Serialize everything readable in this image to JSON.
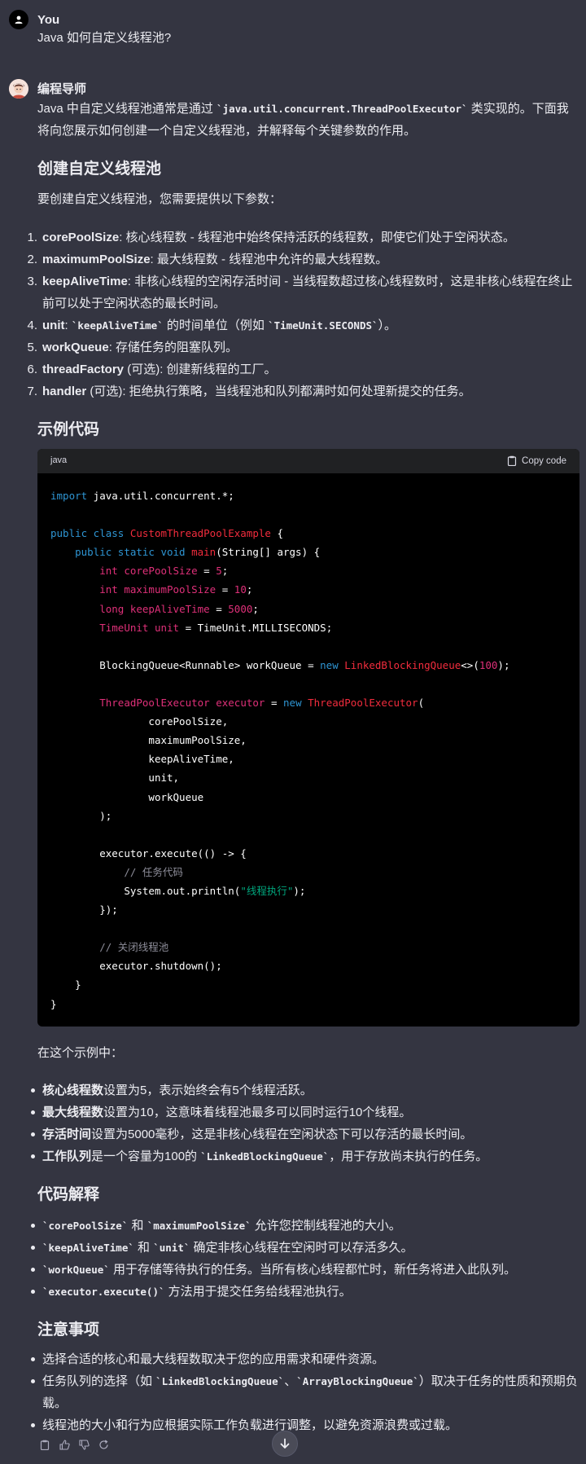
{
  "user": {
    "author": "You",
    "question": "Java 如何自定义线程池?"
  },
  "assistant": {
    "author": "编程导师",
    "intro_pre": "Java 中自定义线程池通常是通过 ",
    "intro_code": "`java.util.concurrent.ThreadPoolExecutor`",
    "intro_post": " 类实现的。下面我将向您展示如何创建一个自定义线程池，并解释每个关键参数的作用。",
    "h_create": "创建自定义线程池",
    "params_intro": "要创建自定义线程池，您需要提供以下参数：",
    "params": [
      {
        "num": "1.",
        "name": "corePoolSize",
        "desc": ": 核心线程数 - 线程池中始终保持活跃的线程数，即使它们处于空闲状态。"
      },
      {
        "num": "2.",
        "name": "maximumPoolSize",
        "desc": ": 最大线程数 - 线程池中允许的最大线程数。"
      },
      {
        "num": "3.",
        "name": "keepAliveTime",
        "desc": ": 非核心线程的空闲存活时间 - 当线程数超过核心线程数时，这是非核心线程在终止前可以处于空闲状态的最长时间。"
      },
      {
        "num": "4.",
        "name": "unit",
        "desc_a": ": ",
        "code_a": "`keepAliveTime`",
        "desc_b": " 的时间单位（例如 ",
        "code_b": "`TimeUnit.SECONDS`",
        "desc_c": "）。"
      },
      {
        "num": "5.",
        "name": "workQueue",
        "desc": ": 存储任务的阻塞队列。"
      },
      {
        "num": "6.",
        "name": "threadFactory",
        "desc": " (可选): 创建新线程的工厂。"
      },
      {
        "num": "7.",
        "name": "handler",
        "desc": " (可选): 拒绝执行策略，当线程池和队列都满时如何处理新提交的任务。"
      }
    ],
    "h_example": "示例代码",
    "code_lang": "java",
    "copy_label": "Copy code",
    "example_intro": "在这个示例中：",
    "example_bullets": [
      {
        "b": "核心线程数",
        "t": "设置为5，表示始终会有5个线程活跃。"
      },
      {
        "b": "最大线程数",
        "t": "设置为10，这意味着线程池最多可以同时运行10个线程。"
      },
      {
        "b": "存活时间",
        "t": "设置为5000毫秒，这是非核心线程在空闲状态下可以存活的最长时间。"
      },
      {
        "b": "工作队列",
        "t_a": "是一个容量为100的 ",
        "c": "`LinkedBlockingQueue`",
        "t_b": "，用于存放尚未执行的任务。"
      }
    ],
    "h_explain": "代码解释",
    "explain_bullets": [
      {
        "c1": "`corePoolSize`",
        "m": " 和 ",
        "c2": "`maximumPoolSize`",
        "t": " 允许您控制线程池的大小。"
      },
      {
        "c1": "`keepAliveTime`",
        "m": " 和 ",
        "c2": "`unit`",
        "t": " 确定非核心线程在空闲时可以存活多久。"
      },
      {
        "c1": "`workQueue`",
        "t": " 用于存储等待执行的任务。当所有核心线程都忙时，新任务将进入此队列。"
      },
      {
        "c1": "`executor.execute()`",
        "t": " 方法用于提交任务给线程池执行。"
      }
    ],
    "h_notes": "注意事项",
    "notes": [
      {
        "t": "选择合适的核心和最大线程数取决于您的应用需求和硬件资源。"
      },
      {
        "t_a": "任务队列的选择（如 ",
        "c1": "`LinkedBlockingQueue`",
        "m": "、",
        "c2": "`ArrayBlockingQueue`",
        "t_b": "）取决于任务的性质和预期负载。"
      },
      {
        "t": "线程池的大小和行为应根据实际工作负载进行调整，以避免资源浪费或过载。"
      }
    ]
  },
  "code": {
    "import_kw": "import",
    "import_rest": " java.util.concurrent.*;",
    "l3_kw": "public class",
    "l3_cls": "CustomThreadPoolExample",
    "l3_rest": " {",
    "l4_kw1": "public static void",
    "l4_fn": "main",
    "l4_rest": "(String[] args) {",
    "l5_ty": "int",
    "l5_var": "corePoolSize",
    "l5_eq": " = ",
    "l5_num": "5",
    "l5_end": ";",
    "l6_ty": "int",
    "l6_var": "maximumPoolSize",
    "l6_eq": " = ",
    "l6_num": "10",
    "l6_end": ";",
    "l7_ty": "long",
    "l7_var": "keepAliveTime",
    "l7_eq": " = ",
    "l7_num": "5000",
    "l7_end": ";",
    "l8_ty": "TimeUnit",
    "l8_var": "unit",
    "l8_rest": " = TimeUnit.MILLISECONDS;",
    "l10_a": "BlockingQueue<Runnable> workQueue = ",
    "l10_kw": "new",
    "l10_cls": "LinkedBlockingQueue",
    "l10_b": "<>(",
    "l10_num": "100",
    "l10_c": ");",
    "l12_ty": "ThreadPoolExecutor",
    "l12_var": "executor",
    "l12_eq": " = ",
    "l12_kw": "new",
    "l12_cls": "ThreadPoolExecutor",
    "l12_end": "(",
    "l13": "corePoolSize,",
    "l14": "maximumPoolSize,",
    "l15": "keepAliveTime,",
    "l16": "unit,",
    "l17": "workQueue",
    "l18": ");",
    "l20": "executor.execute(() -> {",
    "l21_cm": "// 任务代码",
    "l22_a": "System.out.println(",
    "l22_str": "\"线程执行\"",
    "l22_b": ");",
    "l23": "});",
    "l25_cm": "// 关闭线程池",
    "l26": "executor.shutdown();",
    "l27": "}",
    "l28": "}"
  }
}
